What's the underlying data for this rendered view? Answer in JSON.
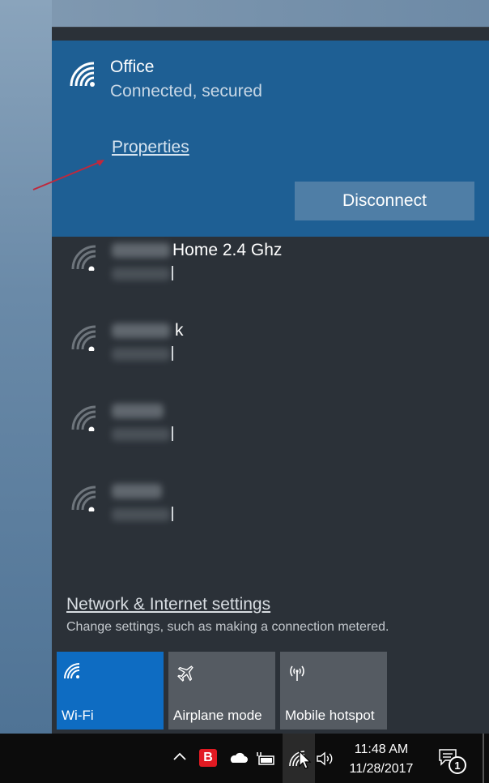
{
  "connected": {
    "name": "Office",
    "status": "Connected, secured",
    "properties_label": "Properties",
    "disconnect_label": "Disconnect"
  },
  "networks": [
    {
      "suffix": "Home 2.4 Ghz"
    },
    {
      "suffix": "k"
    },
    {
      "suffix": ""
    },
    {
      "suffix": ""
    }
  ],
  "settings": {
    "link": "Network & Internet settings",
    "description": "Change settings, such as making a connection metered."
  },
  "quick_actions": [
    {
      "label": "Wi-Fi",
      "icon": "wifi-icon",
      "active": true
    },
    {
      "label": "Airplane mode",
      "icon": "airplane-icon",
      "active": false
    },
    {
      "label": "Mobile hotspot",
      "icon": "hotspot-icon",
      "active": false
    }
  ],
  "taskbar": {
    "time": "11:48 AM",
    "date": "11/28/2017",
    "notification_count": "1",
    "tray_icons": [
      "chevron-up-icon",
      "bitdefender-icon",
      "onedrive-icon",
      "battery-plug-icon",
      "network-icon",
      "volume-icon",
      "action-center-icon"
    ],
    "bitdefender_letter": "B"
  },
  "colors": {
    "accent": "#0e6cc2",
    "connected_bg": "#1e5f94",
    "flyout_bg": "#2b3138",
    "taskbar_bg": "#0c0c0c"
  }
}
